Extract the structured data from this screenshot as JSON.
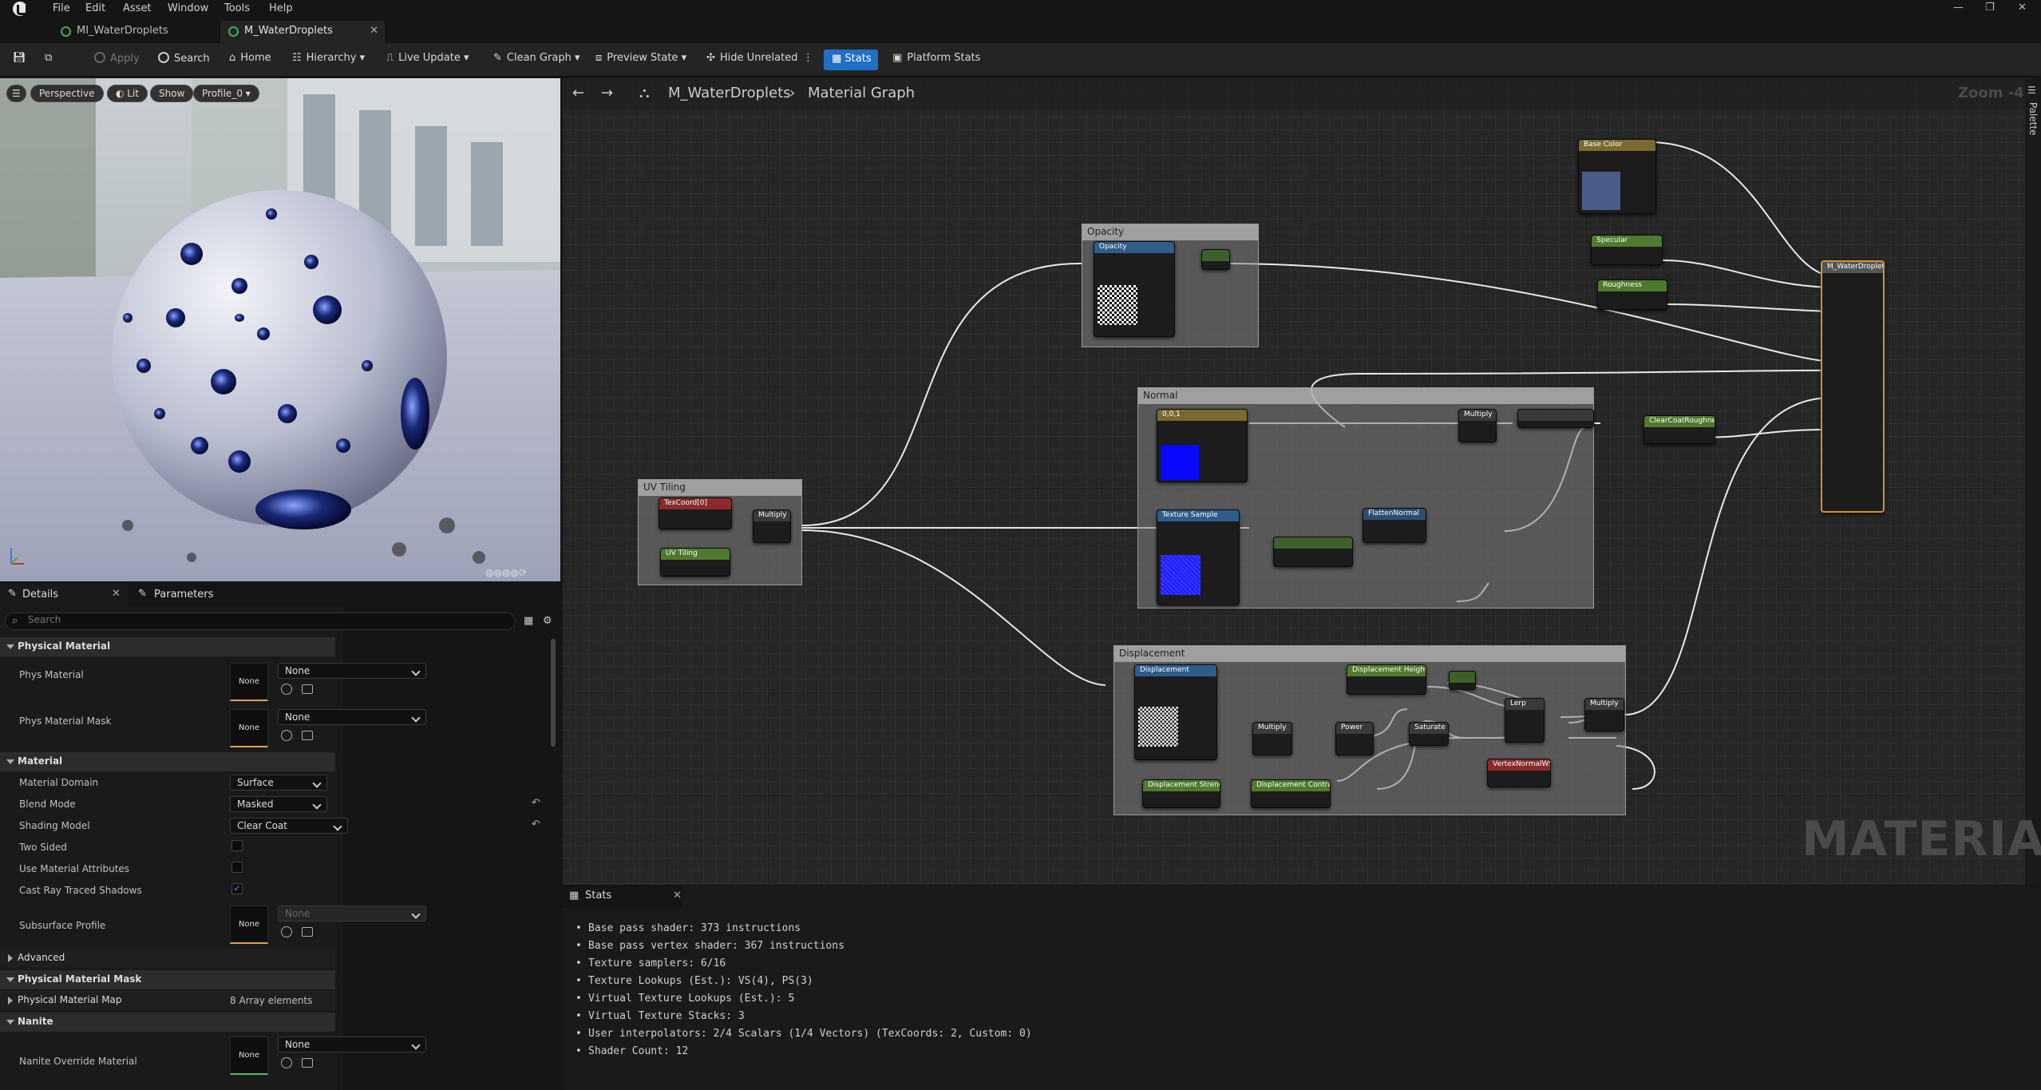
{
  "menu": [
    "File",
    "Edit",
    "Asset",
    "Window",
    "Tools",
    "Help"
  ],
  "tabs": [
    {
      "label": "MI_WaterDroplets"
    },
    {
      "label": "M_WaterDroplets"
    }
  ],
  "toolbar": {
    "apply": "Apply",
    "search": "Search",
    "home": "Home",
    "hierarchy": "Hierarchy",
    "live_update": "Live Update",
    "clean_graph": "Clean Graph",
    "preview_state": "Preview State",
    "hide_unrelated": "Hide Unrelated",
    "stats": "Stats",
    "platform_stats": "Platform Stats"
  },
  "viewport": {
    "perspective": "Perspective",
    "lit": "Lit",
    "show": "Show",
    "profile": "Profile_0"
  },
  "details": {
    "tab_details": "Details",
    "tab_parameters": "Parameters",
    "search_placeholder": "Search",
    "sections": {
      "physical_material": "Physical Material",
      "material": "Material",
      "advanced": "Advanced",
      "physical_material_mask": "Physical Material Mask",
      "nanite": "Nanite"
    },
    "props": {
      "phys_material": "Phys Material",
      "phys_material_mask": "Phys Material Mask",
      "material_domain": "Material Domain",
      "blend_mode": "Blend Mode",
      "shading_model": "Shading Model",
      "two_sided": "Two Sided",
      "use_material_attributes": "Use Material Attributes",
      "cast_ray_traced_shadows": "Cast Ray Traced Shadows",
      "subsurface_profile": "Subsurface Profile",
      "physical_material_map": "Physical Material Map",
      "nanite_override_material": "Nanite Override Material"
    },
    "values": {
      "none": "None",
      "material_domain": "Surface",
      "blend_mode": "Masked",
      "shading_model": "Clear Coat",
      "physical_material_map": "8 Array elements"
    }
  },
  "graph": {
    "breadcrumb_root": "M_WaterDroplets",
    "breadcrumb_leaf": "Material Graph",
    "zoom": "Zoom -4",
    "palette": "Palette",
    "watermark": "MATERIAL",
    "comments": {
      "opacity": "Opacity",
      "normal": "Normal",
      "uv_tiling": "UV Tiling",
      "displacement": "Displacement"
    },
    "nodes": {
      "opacity_tex": "Opacity",
      "normal_const": "0,0,1",
      "texture_sample": "Texture Sample",
      "flatten": "FlattenNormal",
      "multiply": "Multiply",
      "texcoord": "TexCoord[0]",
      "uv_tiling": "UV Tiling",
      "displacement": "Displacement",
      "power": "Power",
      "saturate": "Saturate",
      "lerp": "Lerp",
      "vertex_normal": "VertexNormalWS",
      "disp_strength": "Displacement Strength",
      "disp_contrast": "Displacement Contrast",
      "disp_height": "Displacement Height",
      "base_color": "Base Color",
      "specular": "Specular",
      "roughness": "Roughness",
      "clearcoat_roughness": "ClearCoatRoughness",
      "result": "M_WaterDroplets"
    }
  },
  "stats": {
    "title": "Stats",
    "lines": [
      "Base pass shader: 373 instructions",
      "Base pass vertex shader: 367 instructions",
      "Texture samplers: 6/16",
      "Texture Lookups (Est.): VS(4), PS(3)",
      "Virtual Texture Lookups (Est.): 5",
      "Virtual Texture Stacks: 3",
      "User interpolators: 2/4 Scalars (1/4 Vectors) (TexCoords: 2, Custom: 0)",
      "Shader Count: 12"
    ]
  }
}
